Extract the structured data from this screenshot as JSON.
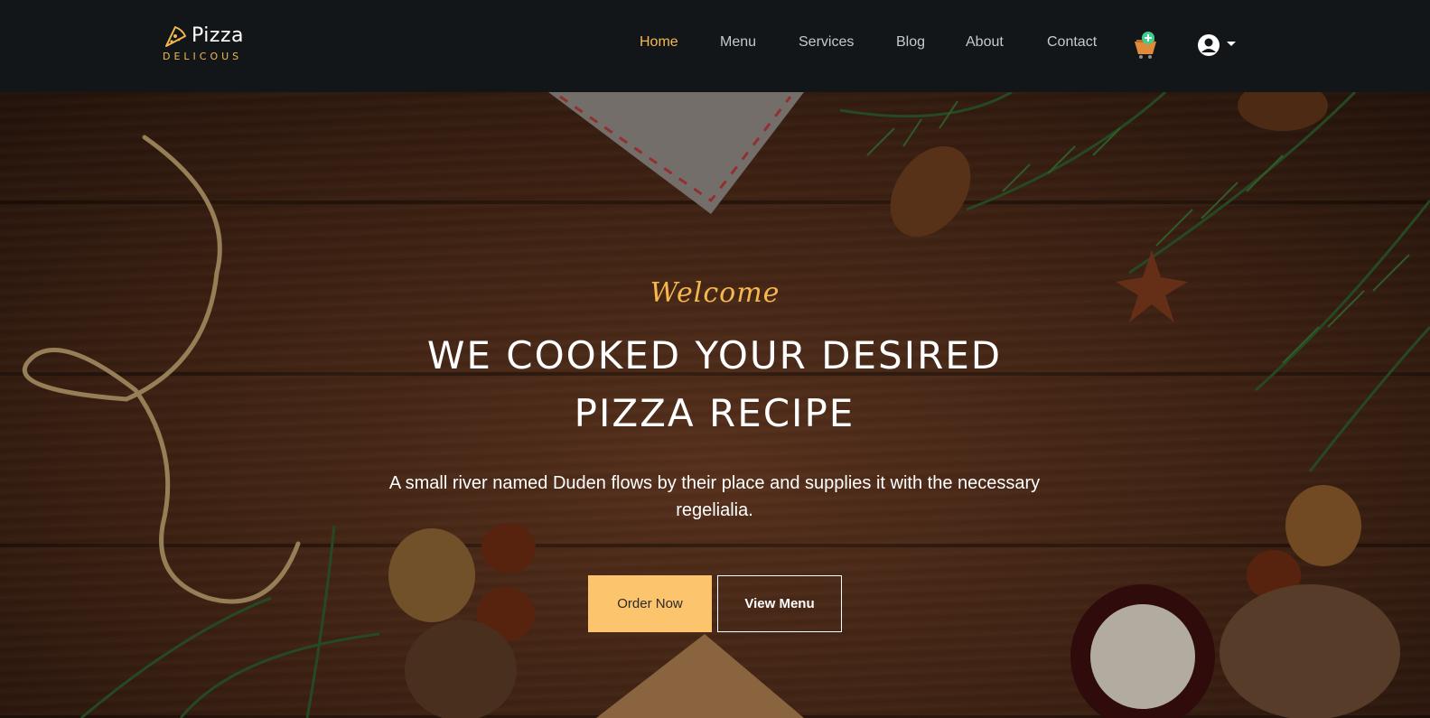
{
  "brand": {
    "title": "Pizza",
    "subtitle": "DELICOUS",
    "icon": "pizza-slice-icon"
  },
  "nav": {
    "items": [
      {
        "label": "Home",
        "active": true
      },
      {
        "label": "Menu",
        "active": false
      },
      {
        "label": "Services",
        "active": false
      },
      {
        "label": "Blog",
        "active": false
      },
      {
        "label": "About",
        "active": false
      },
      {
        "label": "Contact",
        "active": false
      }
    ],
    "cart_icon": "cart-add-icon",
    "user_icon": "user-circle-icon",
    "dropdown_icon": "caret-down-icon"
  },
  "hero": {
    "welcome": "Welcome",
    "headline_line1": "WE COOKED YOUR DESIRED",
    "headline_line2": "PIZZA RECIPE",
    "subtext": "A small river named Duden flows by their place and supplies it with the necessary regelialia.",
    "order_button": "Order Now",
    "menu_button": "View Menu"
  },
  "colors": {
    "navbar_bg": "#121619",
    "accent": "#f5b84f",
    "button_fill": "#fcc46c",
    "wood": "#4a2816"
  }
}
